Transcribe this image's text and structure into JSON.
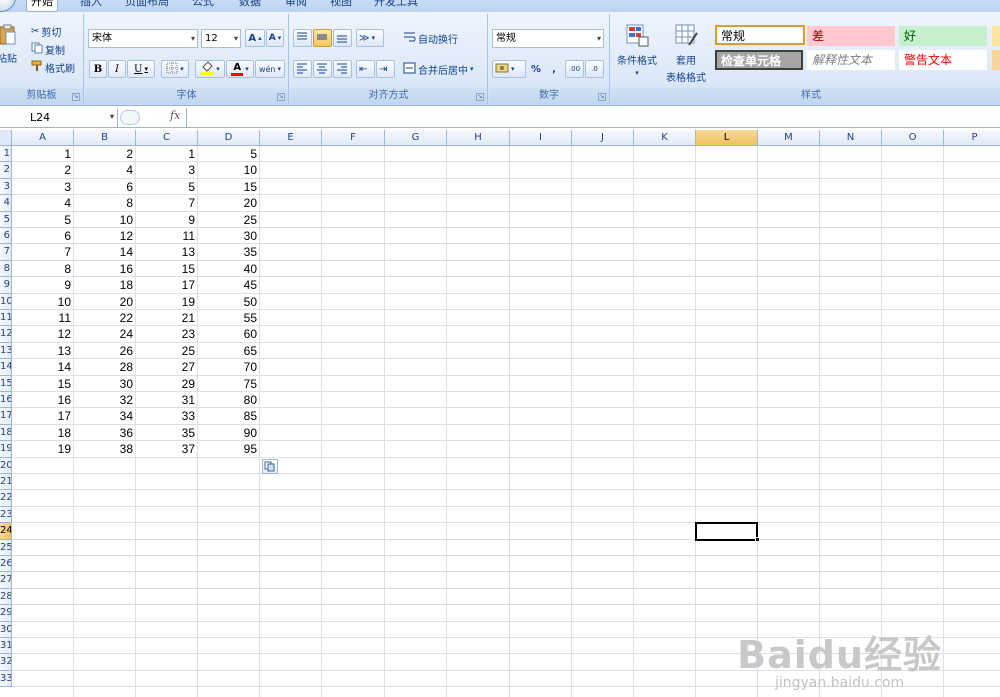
{
  "tabs": [
    "开始",
    "插入",
    "页面布局",
    "公式",
    "数据",
    "审阅",
    "视图",
    "开发工具"
  ],
  "clipboard": {
    "paste_label": "粘贴",
    "cut": "剪切",
    "copy": "复制",
    "format_painter": "格式刷",
    "group_label": "剪贴板"
  },
  "font": {
    "name": "宋体",
    "size": "12",
    "bold": "B",
    "italic": "I",
    "underline": "U",
    "grow": "A",
    "shrink": "A",
    "font_color_glyph": "A",
    "phonetic": "wén",
    "group_label": "字体",
    "fill_color": "#ffff00",
    "font_color": "#ff0000"
  },
  "alignment": {
    "wrap_text": "自动换行",
    "merge_center": "合并后居中",
    "group_label": "对齐方式"
  },
  "number": {
    "format": "常规",
    "percent": "%",
    "comma": ",",
    "inc_decimal": ".00",
    "dec_decimal": ".0",
    "group_label": "数字"
  },
  "styles_group": {
    "conditional_formatting": "条件格式",
    "format_as_table_line1": "套用",
    "format_as_table_line2": "表格格式",
    "group_label": "样式",
    "cells": [
      {
        "label": "常规",
        "bg": "#ffffff",
        "color": "#000000",
        "border": "#e39a2c",
        "bold": false,
        "italic": false
      },
      {
        "label": "差",
        "bg": "#ffc7ce",
        "color": "#9c0006",
        "border": "#ffc7ce",
        "bold": false,
        "italic": false
      },
      {
        "label": "好",
        "bg": "#c6efce",
        "color": "#006100",
        "border": "#c6efce",
        "bold": false,
        "italic": false
      },
      {
        "label": "检查单元格",
        "bg": "#a5a5a5",
        "color": "#ffffff",
        "border": "#3f3f3f",
        "bold": true,
        "italic": false
      },
      {
        "label": "解释性文本",
        "bg": "#ffffff",
        "color": "#7f7f7f",
        "border": "#ffffff",
        "bold": false,
        "italic": true
      },
      {
        "label": "警告文本",
        "bg": "#ffffff",
        "color": "#ff0000",
        "border": "#ffffff",
        "bold": false,
        "italic": false
      }
    ]
  },
  "formula_bar": {
    "name_box": "L24",
    "fx": "fx",
    "formula": ""
  },
  "columns": [
    "A",
    "B",
    "C",
    "D",
    "E",
    "F",
    "G",
    "H",
    "I",
    "J",
    "K",
    "L",
    "M",
    "N",
    "O",
    "P"
  ],
  "selected_column": "L",
  "row_numbers": [
    "1",
    "2",
    "3",
    "4",
    "5",
    "6",
    "7",
    "8",
    "9",
    "10",
    "11",
    "12",
    "13",
    "14",
    "15",
    "16",
    "17",
    "18",
    "19",
    "20",
    "21",
    "22",
    "23",
    "24",
    "25",
    "26",
    "27",
    "28",
    "29",
    "30",
    "31",
    "32",
    "33"
  ],
  "selected_row": "24",
  "data": [
    [
      "1",
      "2",
      "1",
      "5"
    ],
    [
      "2",
      "4",
      "3",
      "10"
    ],
    [
      "3",
      "6",
      "5",
      "15"
    ],
    [
      "4",
      "8",
      "7",
      "20"
    ],
    [
      "5",
      "10",
      "9",
      "25"
    ],
    [
      "6",
      "12",
      "11",
      "30"
    ],
    [
      "7",
      "14",
      "13",
      "35"
    ],
    [
      "8",
      "16",
      "15",
      "40"
    ],
    [
      "9",
      "18",
      "17",
      "45"
    ],
    [
      "10",
      "20",
      "19",
      "50"
    ],
    [
      "11",
      "22",
      "21",
      "55"
    ],
    [
      "12",
      "24",
      "23",
      "60"
    ],
    [
      "13",
      "26",
      "25",
      "65"
    ],
    [
      "14",
      "28",
      "27",
      "70"
    ],
    [
      "15",
      "30",
      "29",
      "75"
    ],
    [
      "16",
      "32",
      "31",
      "80"
    ],
    [
      "17",
      "34",
      "33",
      "85"
    ],
    [
      "18",
      "36",
      "35",
      "90"
    ],
    [
      "19",
      "38",
      "37",
      "95"
    ]
  ],
  "watermark": {
    "brand": "Baidu经验",
    "url": "jingyan.baidu.com"
  }
}
